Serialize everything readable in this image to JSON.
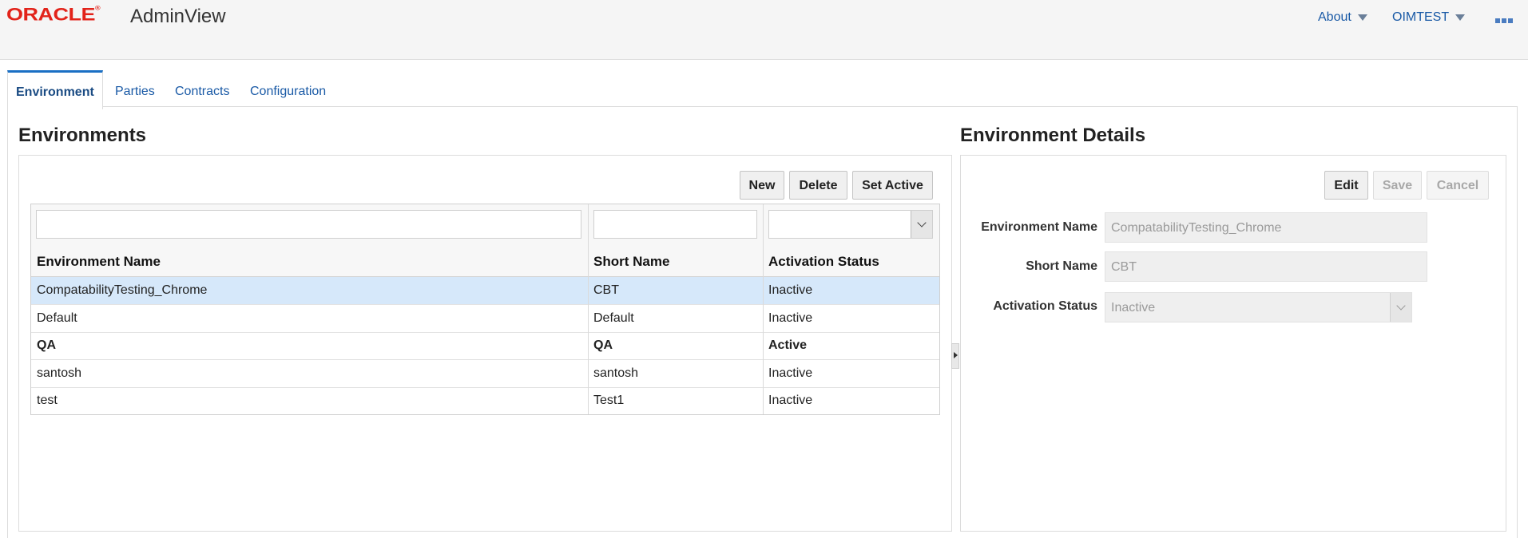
{
  "header": {
    "logo": "ORACLE",
    "app_title": "AdminView",
    "menus": [
      {
        "label": "About"
      },
      {
        "label": "OIMTEST"
      }
    ]
  },
  "tabs": [
    {
      "label": "Environment",
      "active": true
    },
    {
      "label": "Parties"
    },
    {
      "label": "Contracts"
    },
    {
      "label": "Configuration"
    }
  ],
  "environments": {
    "title": "Environments",
    "buttons": {
      "new": "New",
      "delete": "Delete",
      "set_active": "Set Active"
    },
    "filters": {
      "name": "",
      "short_name": "",
      "status": ""
    },
    "columns": [
      "Environment Name",
      "Short Name",
      "Activation Status"
    ],
    "rows": [
      {
        "name": "CompatabilityTesting_Chrome",
        "short_name": "CBT",
        "status": "Inactive",
        "selected": true
      },
      {
        "name": "Default",
        "short_name": "Default",
        "status": "Inactive"
      },
      {
        "name": "QA",
        "short_name": "QA",
        "status": "Active",
        "bold": true
      },
      {
        "name": "santosh",
        "short_name": "santosh",
        "status": "Inactive"
      },
      {
        "name": "test",
        "short_name": "Test1",
        "status": "Inactive"
      }
    ]
  },
  "details": {
    "title": "Environment Details",
    "buttons": {
      "edit": "Edit",
      "save": "Save",
      "cancel": "Cancel"
    },
    "fields": [
      {
        "label": "Environment Name",
        "value": "CompatabilityTesting_Chrome"
      },
      {
        "label": "Short Name",
        "value": "CBT"
      },
      {
        "label": "Activation Status",
        "value": "Inactive"
      }
    ]
  },
  "colors": {
    "brand_red": "#e2231a",
    "link_blue": "#1a5aa6",
    "selected_row": "#d6e8fa"
  }
}
